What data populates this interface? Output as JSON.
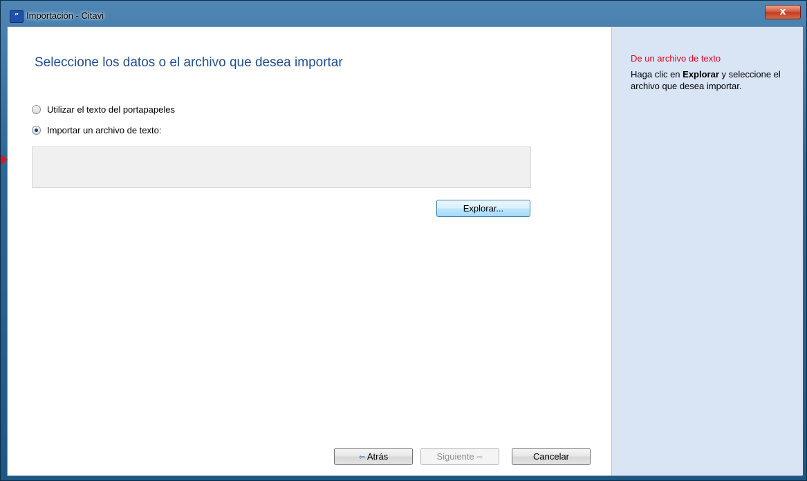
{
  "window": {
    "title": "Importación - Citavi",
    "app_icon": "”",
    "close_glyph": "x"
  },
  "main": {
    "heading": "Seleccione los datos o el archivo que desea importar",
    "options": [
      {
        "label": "Utilizar el texto del portapapeles",
        "checked": false
      },
      {
        "label": "Importar un archivo de texto:",
        "checked": true
      }
    ],
    "file_path_value": "",
    "browse_label": "Explorar..."
  },
  "footer": {
    "back_label": "Atrás",
    "next_label": "Siguiente",
    "cancel_label": "Cancelar"
  },
  "side": {
    "title": "De un archivo de texto",
    "text_pre": "Haga clic en ",
    "text_bold": "Explorar",
    "text_post": " y seleccione el archivo que desea importar."
  },
  "colors": {
    "heading": "#1e4d95",
    "side_title": "#e0001b",
    "side_bg": "#d9e4f5"
  }
}
